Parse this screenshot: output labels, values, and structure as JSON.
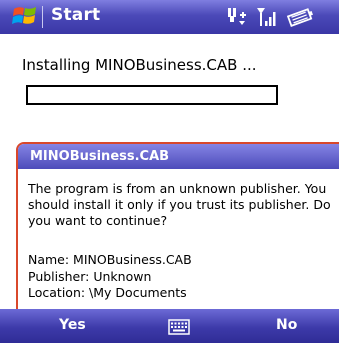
{
  "titlebar": {
    "title": "Start",
    "icons": [
      "windows-logo-icon",
      "connectivity-icon",
      "signal-icon",
      "battery-icon"
    ]
  },
  "install": {
    "status_text": "Installing MINOBusiness.CAB ...",
    "progress": 0
  },
  "dialog": {
    "title": "MINOBusiness.CAB",
    "message": "The program is from an unknown publisher. You should install it only if you trust its publisher. Do you want to continue?",
    "name_line": "Name: MINOBusiness.CAB",
    "publisher_line": "Publisher: Unknown",
    "location_line": "Location: \\My Documents"
  },
  "softkeys": {
    "left": "Yes",
    "right": "No",
    "center_icon": "keyboard-icon"
  },
  "colors": {
    "titlebar": "#4b49b8",
    "dialog_border": "#d9482b",
    "softbar": "#3d3aa9"
  }
}
